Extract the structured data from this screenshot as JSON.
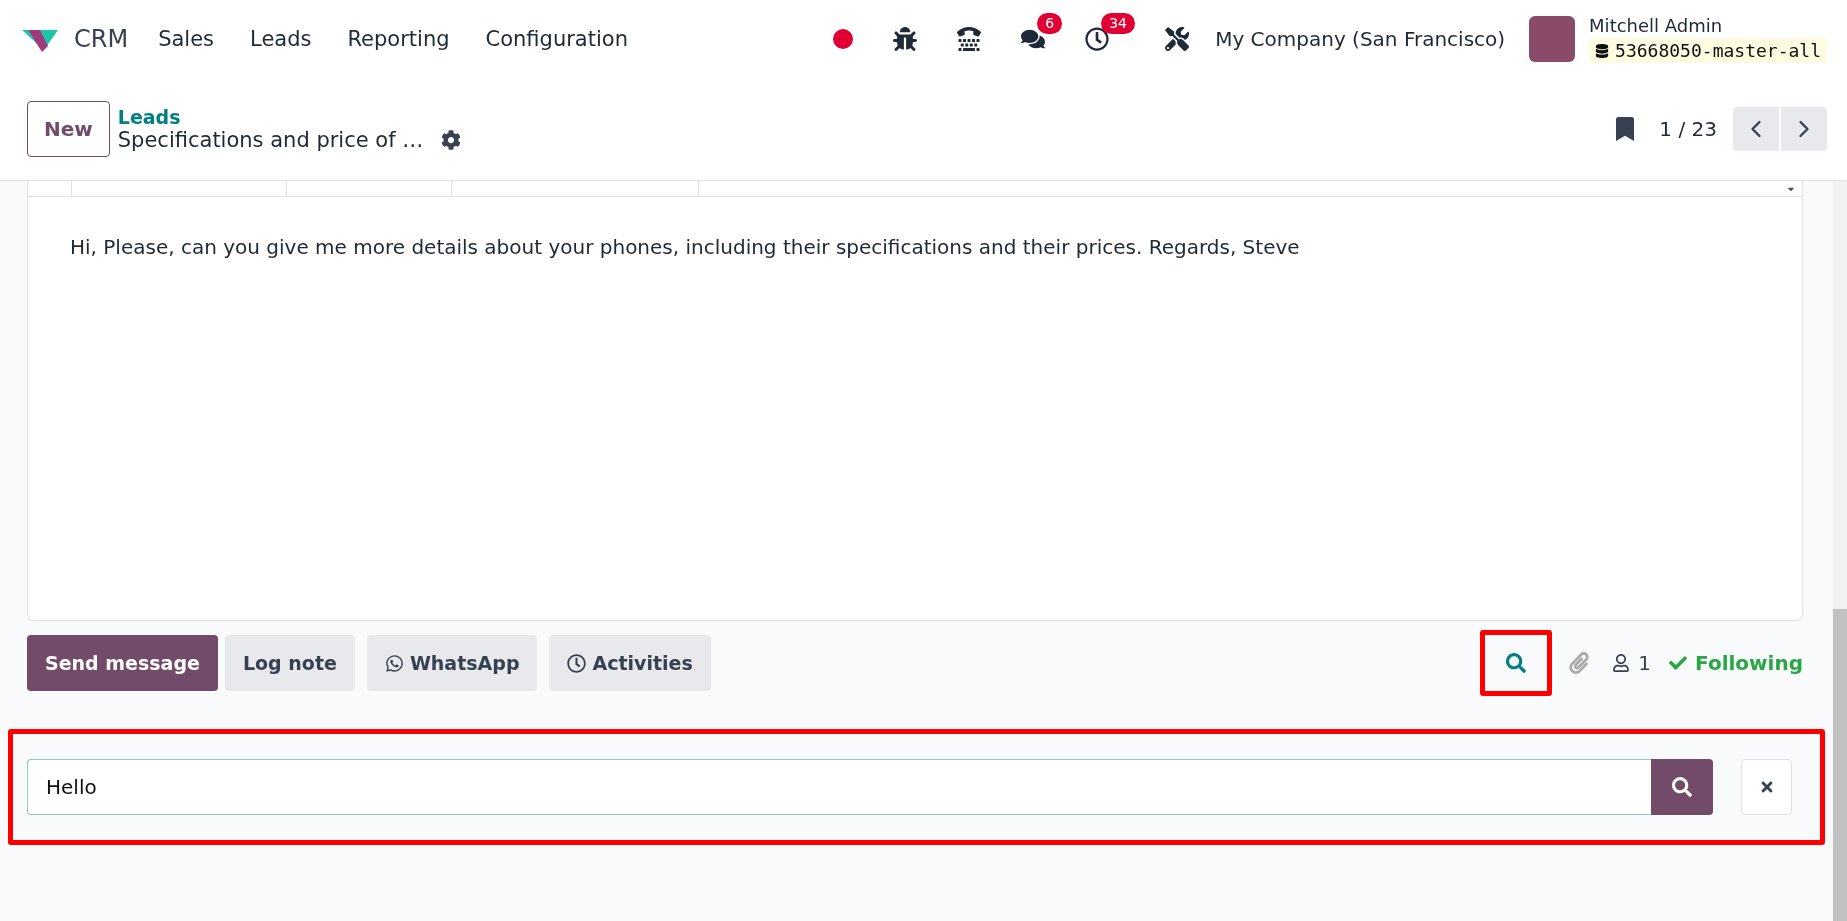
{
  "navbar": {
    "app": "CRM",
    "menu": [
      "Sales",
      "Leads",
      "Reporting",
      "Configuration"
    ],
    "messages_count": "6",
    "activities_count": "34",
    "company": "My Company (San Francisco)",
    "user": "Mitchell Admin",
    "database": "53668050-master-all"
  },
  "control_panel": {
    "new_button": "New",
    "breadcrumb": "Leads",
    "record_title": "Specifications and price of …",
    "pager": "1 / 23"
  },
  "email_body": "Hi, Please, can you give me more details about your phones, including their specifications and their prices. Regards, Steve",
  "chatter": {
    "buttons": [
      {
        "label": "Send message",
        "kind": "primary"
      },
      {
        "label": "Log note",
        "kind": "plain"
      },
      {
        "label": "WhatsApp",
        "kind": "whatsapp"
      },
      {
        "label": "Activities",
        "kind": "activities"
      }
    ],
    "followers": "1",
    "following": "Following",
    "search_highlighted": true
  },
  "search": {
    "value": "Hello",
    "highlighted": true
  }
}
